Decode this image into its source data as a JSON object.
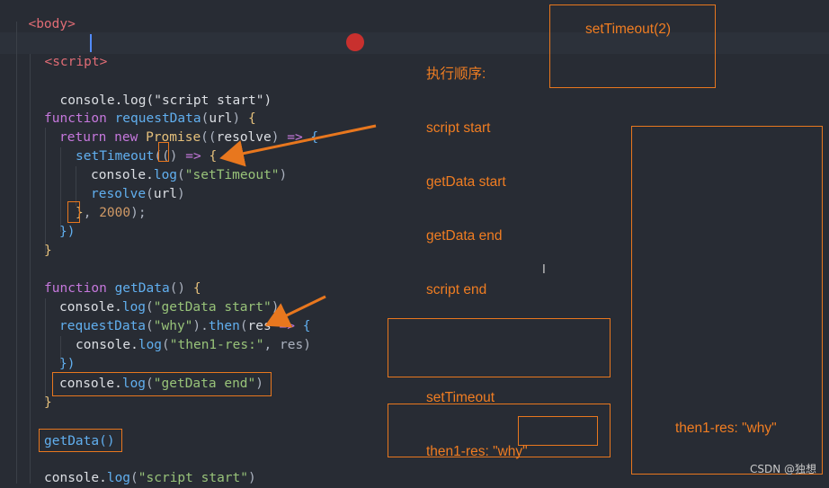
{
  "code": {
    "body_tag": "<body>",
    "script_tag_open": "<script",
    "script_tag_close": ">",
    "l_log1": "console.log(\"script start\")",
    "l_fn1_kw": "function",
    "l_fn1_name": "requestData",
    "l_fn1_param": "url",
    "l_return": "return",
    "l_new": "new",
    "l_promise": "Promise",
    "l_resolve_param": "resolve",
    "l_settimeout": "setTimeout",
    "l_log_settimeout": "\"setTimeout\"",
    "l_resolve": "resolve",
    "l_url": "url",
    "l_delay": "2000",
    "l_fn2_name": "getData",
    "l_log_getdata_start": "\"getData start\"",
    "l_why": "\"why\"",
    "l_then": "then",
    "l_res": "res",
    "l_then1_label": "\"then1-res:\"",
    "l_log_getdata_end": "\"getData end\"",
    "l_call_getdata": "getData()",
    "l_log_script_start2": "\"script start\""
  },
  "notes": {
    "order_title": "执行顺序:",
    "order_items": [
      "script start",
      "getData start",
      "getData end",
      "script end"
    ],
    "later_items": [
      "setTimeout",
      "then1-res: \"why\""
    ],
    "box_settimeout": "setTimeout(2)",
    "box_then": "then1-res: \"why\""
  },
  "watermark": "CSDN @独想",
  "colors": {
    "accent": "#e8771e",
    "background": "#282c34",
    "breakpoint": "#c8302e"
  }
}
